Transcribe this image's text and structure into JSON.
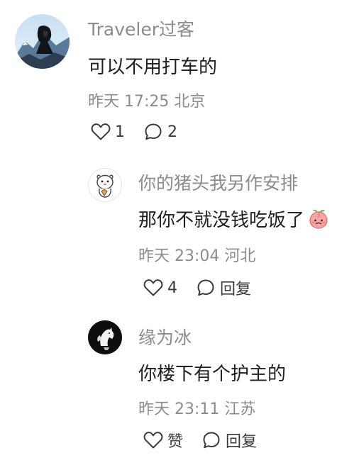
{
  "comments": [
    {
      "username": "Traveler过客",
      "text": "可以不用打车的",
      "time": "昨天 17:25",
      "location": "北京",
      "likes": "1",
      "replies": "2",
      "avatar_icon": "person-hood-mountain-avatar"
    },
    {
      "username": "你的猪头我另作安排",
      "text": "那你不就没钱吃饭了",
      "emoji": "peach-face-emoji",
      "time": "昨天 23:04",
      "location": "河北",
      "likes": "4",
      "reply_label": "回复",
      "avatar_icon": "white-cartoon-avatar"
    },
    {
      "username": "缘为冰",
      "text": "你楼下有个护主的",
      "time": "昨天 23:11",
      "location": "江苏",
      "like_label": "赞",
      "reply_label": "回复",
      "avatar_icon": "dark-horse-avatar"
    }
  ]
}
